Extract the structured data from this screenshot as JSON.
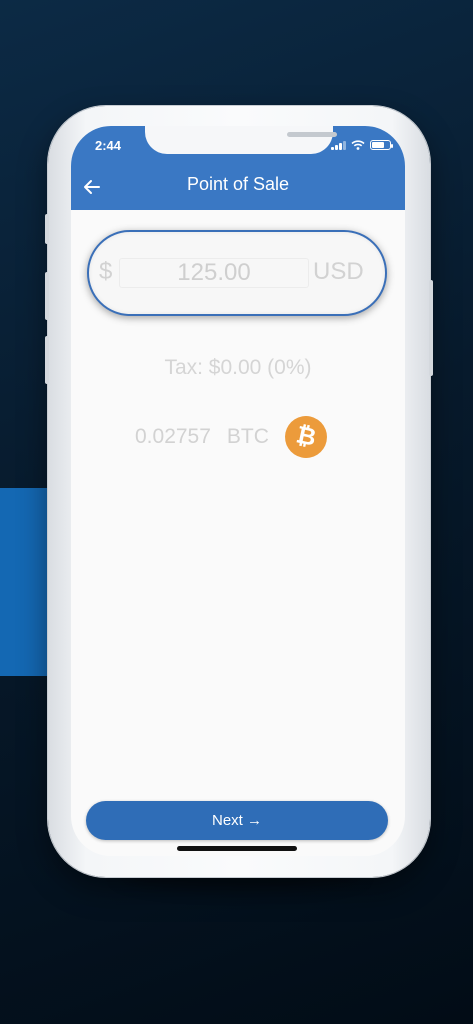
{
  "status_bar": {
    "time": "2:44"
  },
  "app_bar": {
    "title": "Point of Sale",
    "back_icon": "arrow-left-icon"
  },
  "amount": {
    "currency_symbol": "$",
    "value": "125.00",
    "currency_code": "USD"
  },
  "tax": {
    "text": "Tax: $0.00 (0%)"
  },
  "crypto": {
    "amount": "0.02757",
    "unit": "BTC",
    "icon_symbol": "₿"
  },
  "next_button": {
    "label": "Next →"
  },
  "colors": {
    "accent": "#3a78c4",
    "button": "#2f6db7",
    "bitcoin": "#ec9b3b",
    "block": "#1468b3"
  }
}
